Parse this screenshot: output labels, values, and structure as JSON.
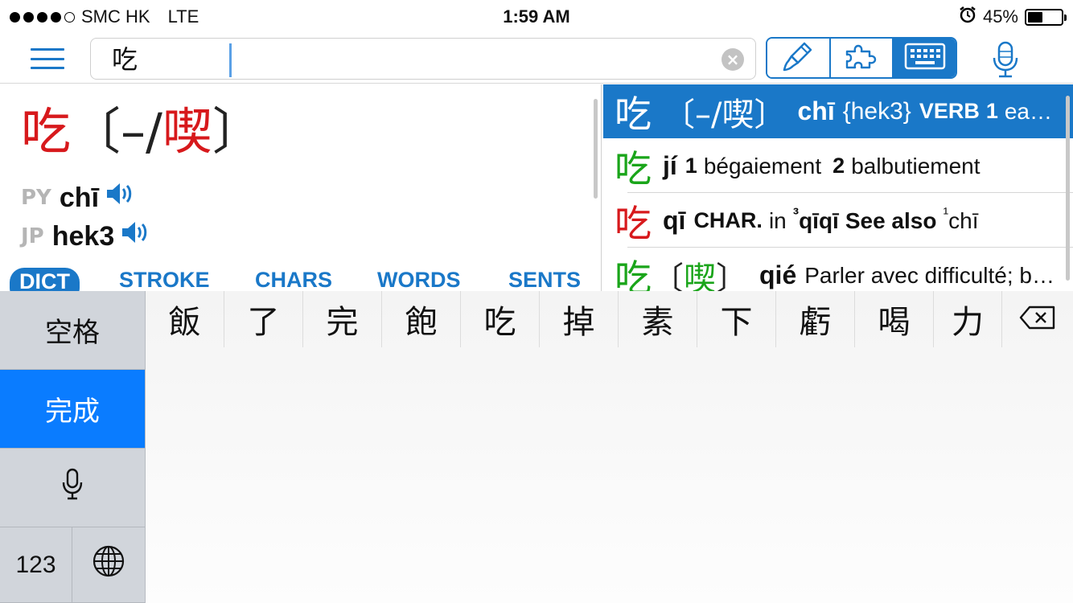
{
  "status_bar": {
    "carrier": "SMC HK",
    "network": "LTE",
    "time": "1:59 AM",
    "battery_text": "45%",
    "battery_level": 0.45,
    "signal_bars": 4,
    "alarm_icon": "alarm-icon"
  },
  "toolbar": {
    "menu_icon": "hamburger-icon",
    "search_value": "吃",
    "clear_icon": "clear-icon",
    "modes": [
      {
        "icon": "brush-icon",
        "active": false
      },
      {
        "icon": "puzzle-icon",
        "active": false
      },
      {
        "icon": "keyboard-icon",
        "active": true
      }
    ],
    "mic_icon": "microphone-icon"
  },
  "entry": {
    "hanzi": "吃",
    "bracket_open": "〔",
    "variant_dash": "–/",
    "variant_char": "喫",
    "bracket_close": "〕",
    "pronunciations": [
      {
        "label": "PY",
        "value": "chī"
      },
      {
        "label": "JP",
        "value": "hek3"
      }
    ],
    "tabs": [
      "DICT",
      "STROKE",
      "CHARS",
      "WORDS",
      "SENTS"
    ],
    "active_tab": "DICT"
  },
  "results": [
    {
      "hanzi": "吃",
      "bracket_open": "〔",
      "variant": "–/喫",
      "bracket_close": "〕",
      "pinyin": "chī",
      "extra": "{hek3}",
      "pos": "VERB",
      "num": "1",
      "def": "ea…",
      "selected": true
    },
    {
      "hanzi": "吃",
      "color": "green",
      "pinyin": "jí",
      "num1": "1",
      "def1": "bégaiement",
      "num2": "2",
      "def2": "balbutiement"
    },
    {
      "hanzi": "吃",
      "color": "red",
      "pinyin": "qī",
      "pos": "CHAR.",
      "word_in": "in",
      "sup1": "³",
      "ref1": "qīqī",
      "see_also": "See also",
      "sup2": "¹",
      "ref2": "chī"
    },
    {
      "hanzi": "吃",
      "color": "green",
      "bracket_open": "〔",
      "variant": "喫",
      "bracket_close": "〕",
      "pinyin": "qié",
      "def": "Parler avec difficulté; b…"
    }
  ],
  "keyboard": {
    "space_label": "空格",
    "done_label": "完成",
    "mic_icon": "microphone-icon",
    "num_label": "123",
    "globe_icon": "globe-icon",
    "candidates": [
      "飯",
      "了",
      "完",
      "飽",
      "吃",
      "掉",
      "素",
      "下",
      "虧",
      "喝",
      "力"
    ],
    "backspace_icon": "backspace-icon"
  },
  "colors": {
    "accent": "#1a78c8",
    "tone_red": "#d7191c",
    "tone_green": "#1aa51a",
    "keyboard_done": "#0a7cff"
  }
}
